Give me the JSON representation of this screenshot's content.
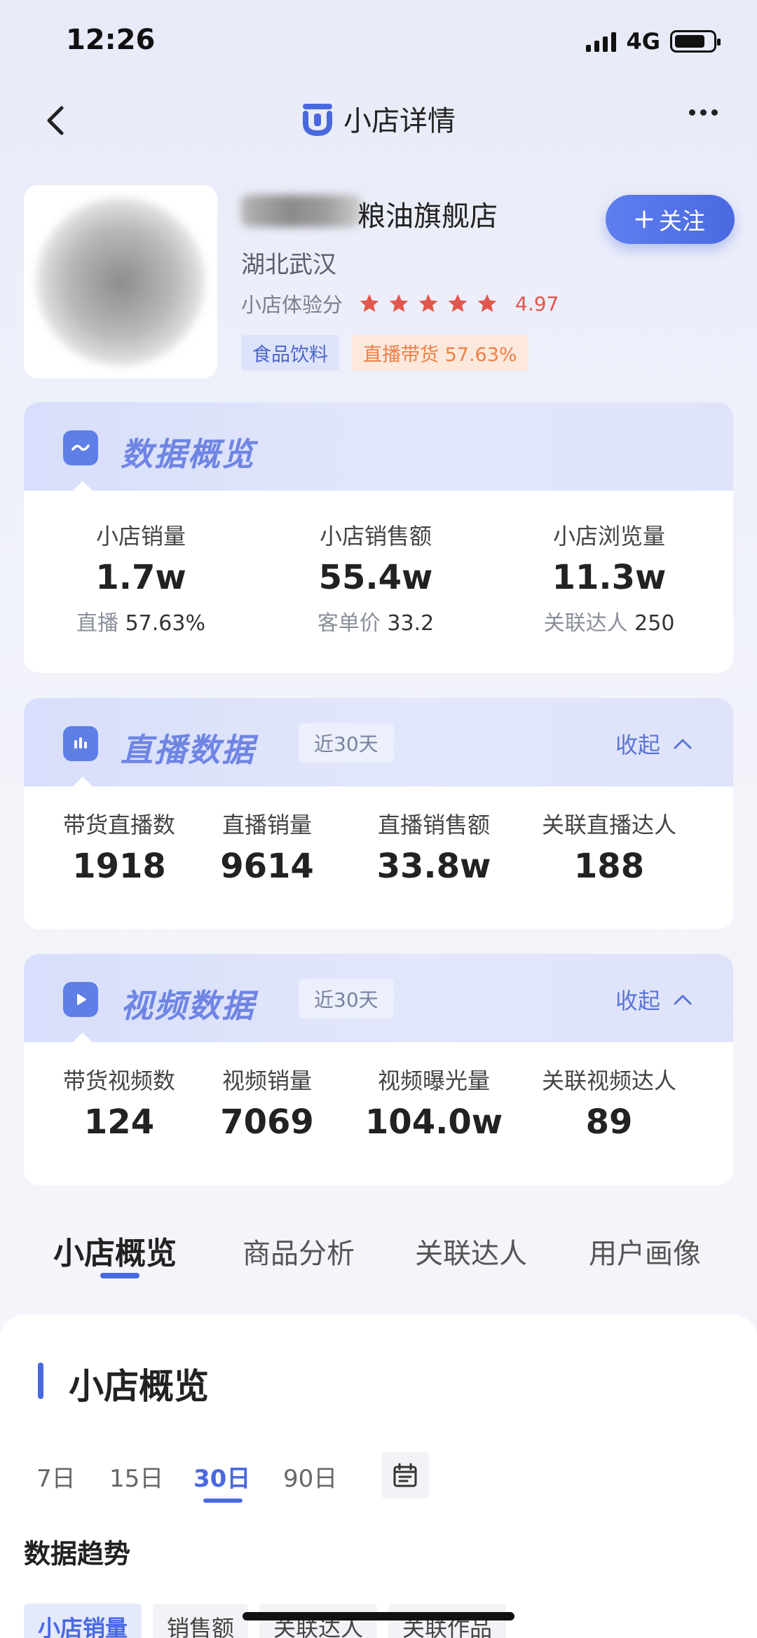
{
  "status_bar": {
    "time": "12:26",
    "network": "4G"
  },
  "nav": {
    "title": "小店详情"
  },
  "shop": {
    "name_visible": "粮油旗舰店",
    "location": "湖北武汉",
    "score_label": "小店体验分",
    "score": "4.97",
    "rating_stars": 5,
    "tags": [
      "食品饮料",
      "直播带货 57.63%"
    ],
    "follow_label": "关注"
  },
  "overview": {
    "title": "数据概览",
    "stats": [
      {
        "label": "小店销量",
        "value": "1.7w",
        "sub_label": "直播",
        "sub_value": "57.63%"
      },
      {
        "label": "小店销售额",
        "value": "55.4w",
        "sub_label": "客单价",
        "sub_value": "33.2"
      },
      {
        "label": "小店浏览量",
        "value": "11.3w",
        "sub_label": "关联达人",
        "sub_value": "250"
      }
    ]
  },
  "live": {
    "title": "直播数据",
    "range": "近30天",
    "collapse_label": "收起",
    "stats": [
      {
        "label": "带货直播数",
        "value": "1918"
      },
      {
        "label": "直播销量",
        "value": "9614"
      },
      {
        "label": "直播销售额",
        "value": "33.8w"
      },
      {
        "label": "关联直播达人",
        "value": "188"
      }
    ]
  },
  "video": {
    "title": "视频数据",
    "range": "近30天",
    "collapse_label": "收起",
    "stats": [
      {
        "label": "带货视频数",
        "value": "124"
      },
      {
        "label": "视频销量",
        "value": "7069"
      },
      {
        "label": "视频曝光量",
        "value": "104.0w"
      },
      {
        "label": "关联视频达人",
        "value": "89"
      }
    ]
  },
  "tabs": [
    "小店概览",
    "商品分析",
    "关联达人",
    "用户画像"
  ],
  "section": {
    "title": "小店概览",
    "periods": [
      "7日",
      "15日",
      "30日",
      "90日"
    ],
    "active_period": "30日",
    "trend_title": "数据趋势",
    "chips": [
      "小店销量",
      "销售额",
      "关联达人",
      "关联作品"
    ]
  },
  "colors": {
    "accent": "#4a69e0",
    "star": "#e2574c",
    "tag_orange": "#ee7f46"
  }
}
